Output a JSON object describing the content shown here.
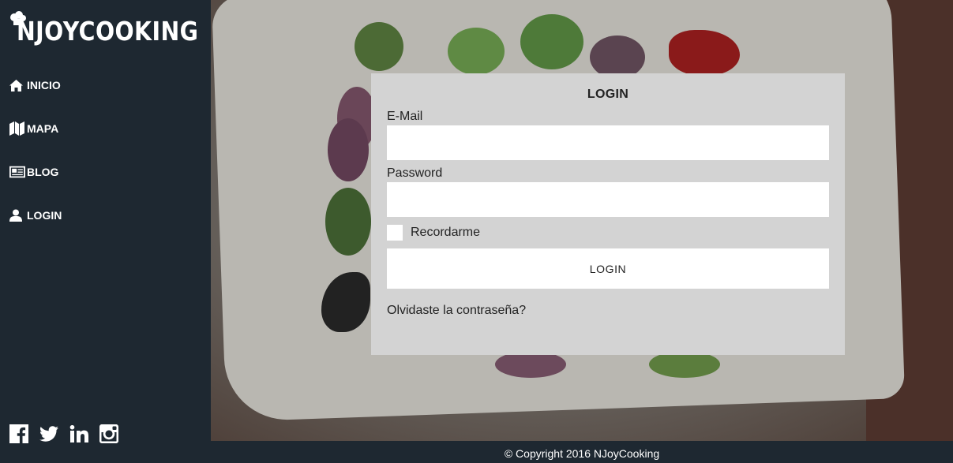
{
  "brand": {
    "name": "NJOYCOOKING"
  },
  "nav": {
    "items": [
      {
        "label": "INICIO",
        "icon": "home-icon"
      },
      {
        "label": "MAPA",
        "icon": "map-icon"
      },
      {
        "label": "BLOG",
        "icon": "newspaper-icon"
      },
      {
        "label": "LOGIN",
        "icon": "user-icon"
      }
    ]
  },
  "social": [
    "facebook-icon",
    "twitter-icon",
    "linkedin-icon",
    "instagram-icon"
  ],
  "login": {
    "title": "LOGIN",
    "email_label": "E-Mail",
    "email_value": "",
    "password_label": "Password",
    "password_value": "",
    "remember_label": "Recordarme",
    "remember_checked": false,
    "submit_label": "LOGIN",
    "forgot_label": "Olvidaste la contraseña?"
  },
  "footer": {
    "copyright": "© Copyright 2016 NJoyCooking"
  },
  "colors": {
    "sidebar_bg": "#1e2831",
    "panel_bg": "#d3d3d3",
    "text": "#222222",
    "white": "#ffffff"
  }
}
